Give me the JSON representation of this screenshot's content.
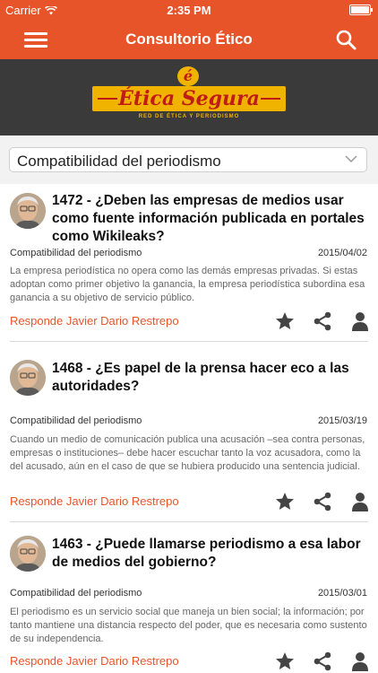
{
  "status_bar": {
    "carrier": "Carrier",
    "time": "2:35 PM"
  },
  "nav": {
    "title": "Consultorio Ético",
    "menu_icon": "hamburger-icon",
    "search_icon": "search-icon"
  },
  "banner": {
    "logo_name": "Ética Segura",
    "logo_mark": "é",
    "tagline": "RED DE ÉTICA Y PERIODISMO",
    "colors": {
      "band": "#f0b400",
      "text": "#c01c16",
      "background": "#3a3a3a"
    }
  },
  "filter": {
    "selected": "Compatibilidad del periodismo"
  },
  "colors": {
    "accent": "#e8542a"
  },
  "articles": [
    {
      "title": "1472 - ¿Deben las empresas de medios usar como fuente información publicada en portales como Wikileaks?",
      "category": "Compatibilidad del periodismo",
      "date": "2015/04/02",
      "excerpt": "La empresa periodística no opera como las demás empresas privadas. Si estas adoptan como primer objetivo la ganancia, la empresa periodística subordina esa ganancia a su objetivo de servicio público.",
      "author": "Responde Javier Dario Restrepo"
    },
    {
      "title": "1468 - ¿Es papel de la prensa hacer eco a las autoridades?",
      "category": "Compatibilidad del periodismo",
      "date": "2015/03/19",
      "excerpt": "Cuando un medio de comunicación publica una acusación –sea contra personas, empresas o instituciones– debe hacer escuchar tanto la voz acusadora, como la del acusado, aún en el caso de que se hubiera producido una sentencia judicial.",
      "author": "Responde Javier Dario Restrepo"
    },
    {
      "title": "1463 - ¿Puede llamarse periodismo a esa labor de medios del gobierno?",
      "category": "Compatibilidad del periodismo",
      "date": "2015/03/01",
      "excerpt": "El periodismo es un servicio social que maneja un bien social; la información; por tanto mantiene una distancia respecto del poder, que es necesaria como sustento de su independencia.",
      "author": "Responde Javier Dario Restrepo"
    }
  ]
}
